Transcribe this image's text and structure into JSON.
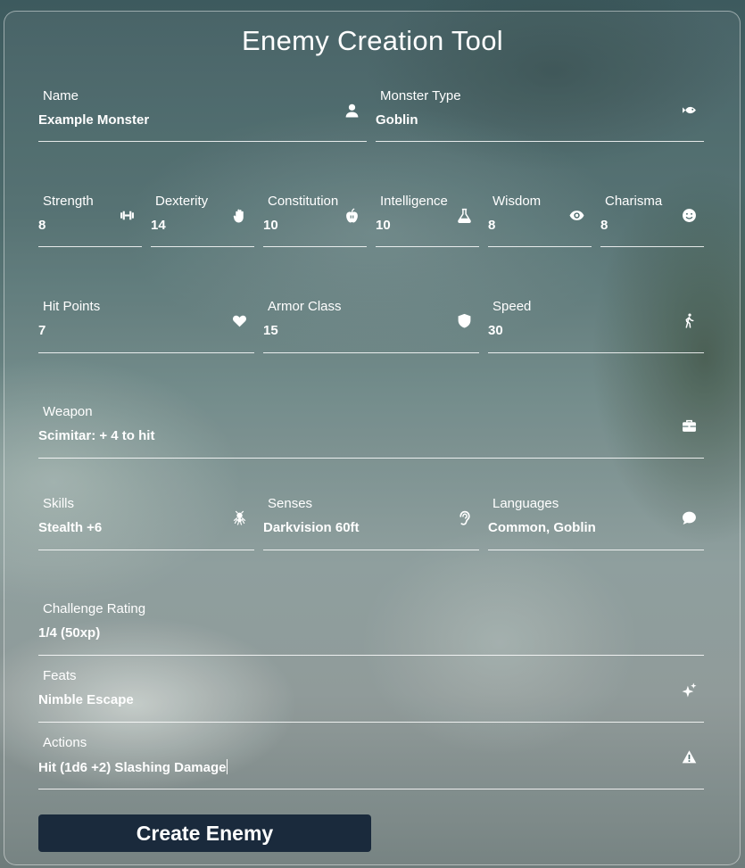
{
  "form": {
    "title": "Enemy Creation Tool",
    "name": {
      "label": "Name",
      "value": "Example Monster",
      "icon": "person-icon"
    },
    "monster_type": {
      "label": "Monster Type",
      "value": "Goblin",
      "icon": "fish-icon"
    },
    "abilities": [
      {
        "label": "Strength",
        "value": "8",
        "icon": "dumbbell-icon"
      },
      {
        "label": "Dexterity",
        "value": "14",
        "icon": "hand-icon"
      },
      {
        "label": "Constitution",
        "value": "10",
        "icon": "apple-icon"
      },
      {
        "label": "Intelligence",
        "value": "10",
        "icon": "flask-icon"
      },
      {
        "label": "Wisdom",
        "value": "8",
        "icon": "eye-icon"
      },
      {
        "label": "Charisma",
        "value": "8",
        "icon": "smile-icon"
      }
    ],
    "hit_points": {
      "label": "Hit Points",
      "value": "7",
      "icon": "heart-icon"
    },
    "armor_class": {
      "label": "Armor Class",
      "value": "15",
      "icon": "shield-icon"
    },
    "speed": {
      "label": "Speed",
      "value": "30",
      "icon": "walking-icon"
    },
    "weapon": {
      "label": "Weapon",
      "value": "Scimitar: + 4 to hit",
      "icon": "toolbox-icon"
    },
    "skills": {
      "label": "Skills",
      "value": "Stealth +6",
      "icon": "spider-icon"
    },
    "senses": {
      "label": "Senses",
      "value": "Darkvision 60ft",
      "icon": "ear-icon"
    },
    "languages": {
      "label": "Languages",
      "value": "Common, Goblin",
      "icon": "speech-bubble-icon"
    },
    "challenge_rating": {
      "label": "Challenge Rating",
      "value": "1/4 (50xp)"
    },
    "feats": {
      "label": "Feats",
      "value": "Nimble Escape",
      "icon": "sparkles-icon"
    },
    "actions": {
      "label": "Actions",
      "value": "Hit (1d6 +2) Slashing Damage",
      "icon": "warning-icon"
    },
    "submit_label": "Create Enemy"
  },
  "colors": {
    "button_bg": "#1a2a3c",
    "text": "#ffffff"
  }
}
